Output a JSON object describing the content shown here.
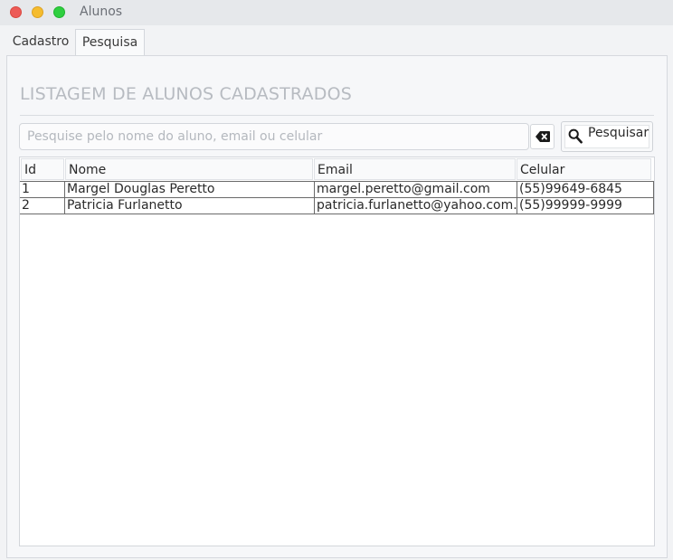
{
  "window": {
    "title": "Alunos"
  },
  "tabs": [
    {
      "label": "Cadastro",
      "active": false
    },
    {
      "label": "Pesquisa",
      "active": true
    }
  ],
  "page": {
    "heading": "LISTAGEM DE ALUNOS CADASTRADOS"
  },
  "search": {
    "placeholder": "Pesquise pelo nome do aluno, email ou celular",
    "value": "",
    "clear_icon": "backspace-clear-icon",
    "button_icon": "magnifier-search-icon",
    "button_label": "Pesquisar"
  },
  "table": {
    "columns": [
      "Id",
      "Nome",
      "Email",
      "Celular"
    ],
    "rows": [
      [
        "1",
        "Margel Douglas Peretto",
        "margel.peretto@gmail.com",
        "(55)99649-6845"
      ],
      [
        "2",
        "Patricia Furlanetto",
        "patricia.furlanetto@yahoo.com...",
        "(55)99999-9999"
      ]
    ]
  },
  "colors": {
    "close": "#ed5b57",
    "minimize": "#f5bc2f",
    "maximize": "#2fcf40",
    "heading": "#b7bbc1"
  }
}
